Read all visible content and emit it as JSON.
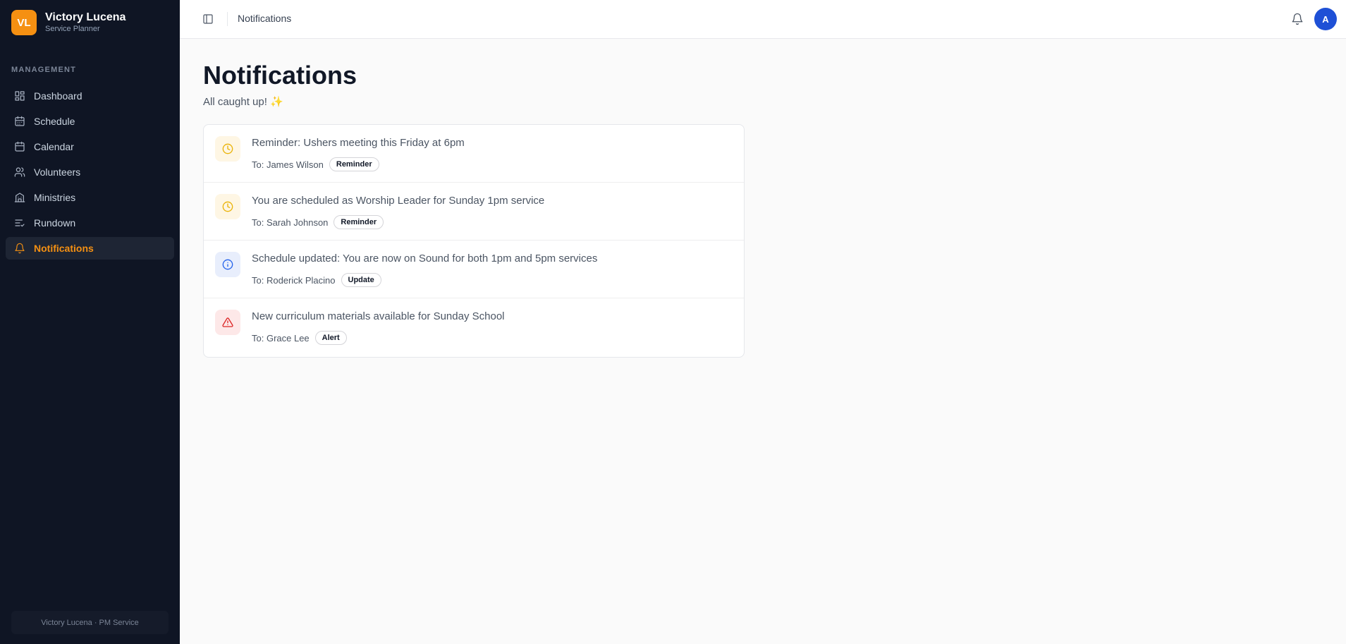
{
  "brand": {
    "initials": "VL",
    "name": "Victory Lucena",
    "subtitle": "Service Planner",
    "logo_color": "#f59012"
  },
  "sidebar": {
    "section": "MANAGEMENT",
    "items": [
      {
        "label": "Dashboard",
        "icon": "dashboard-icon",
        "active": false
      },
      {
        "label": "Schedule",
        "icon": "calendar-grid-icon",
        "active": false
      },
      {
        "label": "Calendar",
        "icon": "calendar-icon",
        "active": false
      },
      {
        "label": "Volunteers",
        "icon": "users-icon",
        "active": false
      },
      {
        "label": "Ministries",
        "icon": "building-icon",
        "active": false
      },
      {
        "label": "Rundown",
        "icon": "list-check-icon",
        "active": false
      },
      {
        "label": "Notifications",
        "icon": "bell-icon",
        "active": true
      }
    ],
    "footer": "Victory Lucena · PM Service"
  },
  "topbar": {
    "title": "Notifications",
    "avatar_initial": "A"
  },
  "main": {
    "title": "Notifications",
    "subtitle": "All caught up! ✨"
  },
  "notifications": [
    {
      "message": "Reminder: Ushers meeting this Friday at 6pm",
      "to": "To: James Wilson",
      "badge": "Reminder",
      "icon": "clock-icon",
      "icon_color": "#eab308",
      "icon_bg": "#fef6e4"
    },
    {
      "message": "You are scheduled as Worship Leader for Sunday 1pm service",
      "to": "To: Sarah Johnson",
      "badge": "Reminder",
      "icon": "clock-icon",
      "icon_color": "#eab308",
      "icon_bg": "#fef6e4"
    },
    {
      "message": "Schedule updated: You are now on Sound for both 1pm and 5pm services",
      "to": "To: Roderick Placino",
      "badge": "Update",
      "icon": "info-icon",
      "icon_color": "#2563eb",
      "icon_bg": "#e8eefc"
    },
    {
      "message": "New curriculum materials available for Sunday School",
      "to": "To: Grace Lee",
      "badge": "Alert",
      "icon": "alert-triangle-icon",
      "icon_color": "#dc2626",
      "icon_bg": "#fde8e8"
    }
  ]
}
